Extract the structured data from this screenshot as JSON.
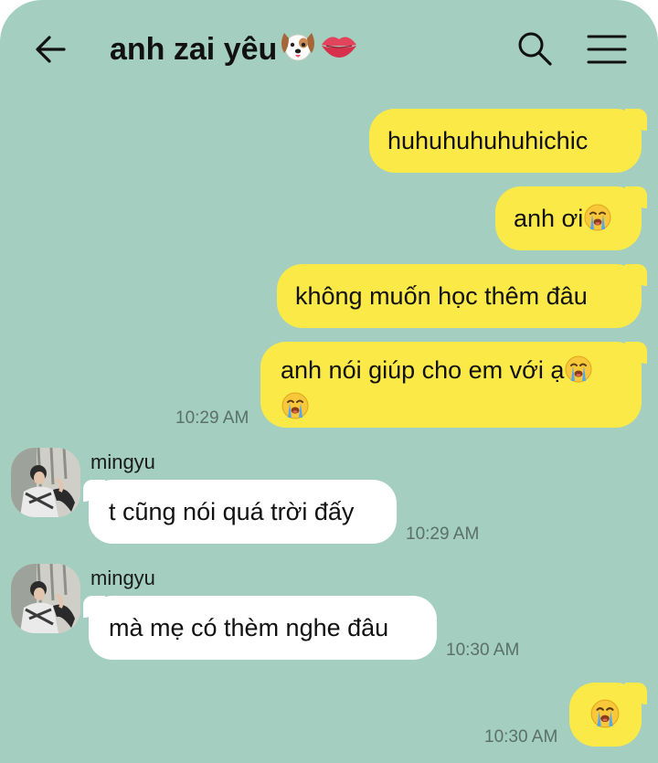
{
  "header": {
    "title": "anh zai yêu",
    "title_emojis": [
      "dog-face-emoji",
      "lips-emoji"
    ],
    "back_icon": "arrow-left-icon",
    "search_icon": "search-icon",
    "menu_icon": "hamburger-menu-icon"
  },
  "colors": {
    "background": "#a3cec0",
    "outgoing_bubble": "#fbe947",
    "incoming_bubble": "#ffffff"
  },
  "messages": {
    "m1": {
      "text": "huhuhuhuhuhichic"
    },
    "m2": {
      "text": "anh ơi",
      "emoji": "loudly-crying-face-emoji"
    },
    "m3": {
      "text": "không muốn học thêm đâu"
    },
    "m4": {
      "text": "anh nói giúp cho em với ạ",
      "emoji": "loudly-crying-face-emoji",
      "time": "10:29 AM"
    },
    "m5": {
      "sender": "mingyu",
      "text": "t cũng nói quá trời đấy",
      "time": "10:29 AM"
    },
    "m6": {
      "sender": "mingyu",
      "text": "mà mẹ có thèm nghe đâu",
      "time": "10:30 AM"
    },
    "m7": {
      "emoji": "loudly-crying-face-emoji",
      "time": "10:30 AM"
    }
  }
}
